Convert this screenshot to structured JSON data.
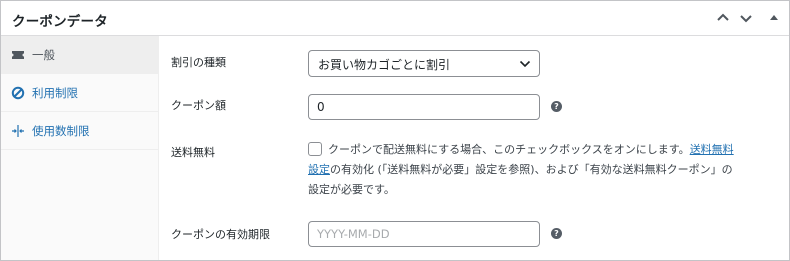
{
  "panel": {
    "title": "クーポンデータ"
  },
  "header_controls": [
    "chevron-up-icon",
    "chevron-down-icon",
    "triangle-up-icon"
  ],
  "tabs": [
    {
      "label": "一般",
      "icon": "ticket-icon",
      "active": true
    },
    {
      "label": "利用制限",
      "icon": "no-entry-icon",
      "active": false
    },
    {
      "label": "使用数制限",
      "icon": "arrows-icon",
      "active": false
    }
  ],
  "fields": {
    "discount_type": {
      "label": "割引の種類",
      "value": "お買い物カゴごとに割引"
    },
    "amount": {
      "label": "クーポン額",
      "value": "0"
    },
    "free_shipping": {
      "label": "送料無料",
      "text_1": "クーポンで配送無料にする場合、このチェックボックスをオンにします。",
      "link_1a": "送料無料",
      "link_1b": "設定",
      "text_2": "の有効化 (「送料無料が必要」設定を参照)、および「有効な送料無料クーポン」の",
      "text_3": "設定が必要です。"
    },
    "expiry": {
      "label": "クーポンの有効期限",
      "placeholder": "YYYY-MM-DD"
    }
  },
  "colors": {
    "link": "#2271b1",
    "border": "#c3c4c7",
    "active_tab": "#eeeeee"
  }
}
